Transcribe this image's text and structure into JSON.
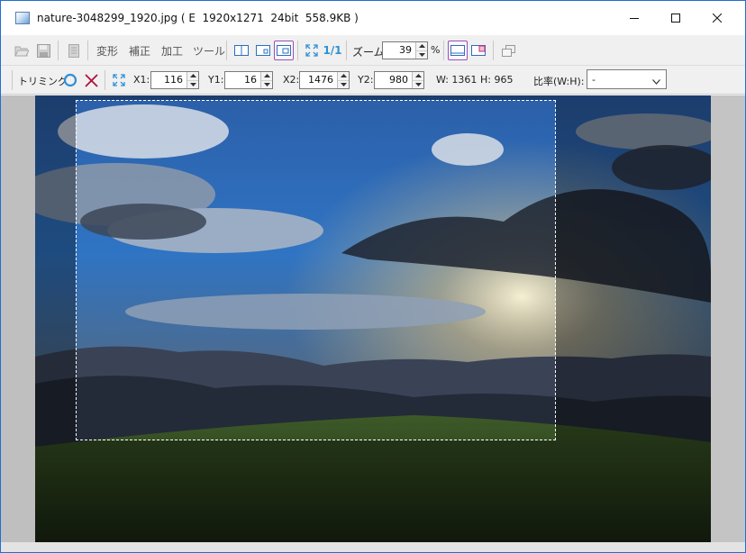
{
  "window": {
    "title": "nature-3048299_1920.jpg ( E  1920x1271  24bit  558.9KB )"
  },
  "toolbar": {
    "menus": [
      "変形",
      "補正",
      "加工",
      "ツール"
    ],
    "zoom_label": "ズーム:",
    "zoom_value": "39",
    "zoom_unit": "%",
    "fit_ratio_label": "1/1"
  },
  "trim": {
    "label": "トリミング",
    "x1_label": "X1:",
    "x1": "116",
    "y1_label": "Y1:",
    "y1": "16",
    "x2_label": "X2:",
    "x2": "1476",
    "y2_label": "Y2:",
    "y2": "980",
    "width_text": "W: 1361",
    "height_text": "H: 965",
    "ratio_label": "比率(W:H):",
    "ratio_value": "-"
  },
  "colors": {
    "accent": "#9a4fb6",
    "confirm": "#2f8fd6",
    "cancel": "#b0103a",
    "title_border": "#1f6fd0"
  },
  "icons": [
    "app-icon",
    "open-icon",
    "save-icon",
    "copy-icon",
    "view-split-icon",
    "view-window-icon",
    "view-panel-icon",
    "fit-icon",
    "fit-ratio-icon",
    "layout-bottom-icon",
    "layout-right-icon",
    "window-icon",
    "ok-circle-icon",
    "cancel-x-icon",
    "fit-selection-icon"
  ]
}
